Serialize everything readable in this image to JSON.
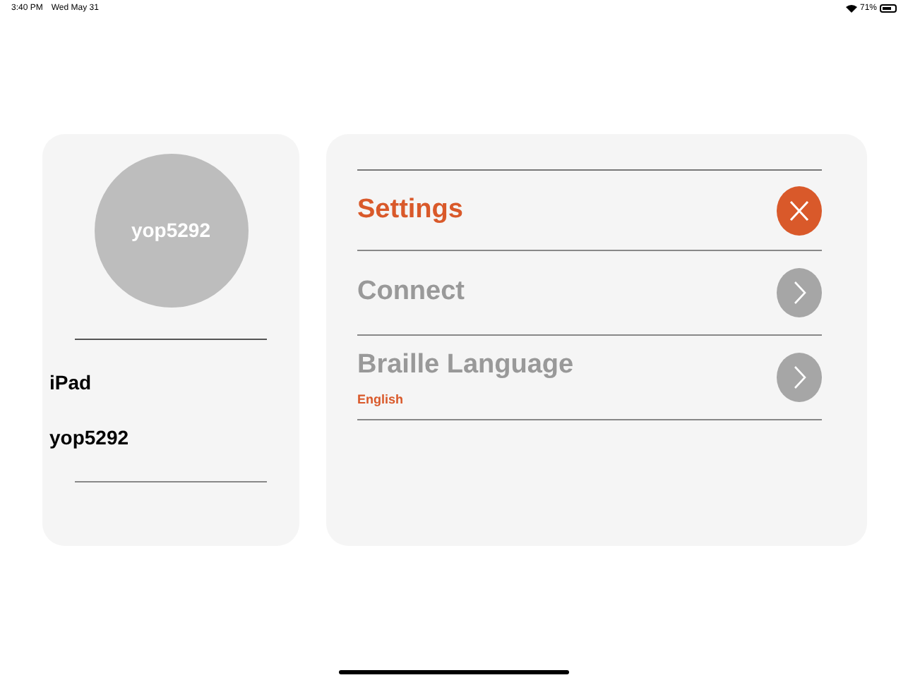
{
  "status_bar": {
    "time": "3:40 PM",
    "date": "Wed May 31",
    "battery": "71%"
  },
  "profile": {
    "avatar_text": "yop5292",
    "device": "iPad",
    "name": "yop5292"
  },
  "menu": [
    {
      "label": "Settings",
      "selected": true
    },
    {
      "label": "Connect",
      "selected": false
    },
    {
      "label": "Braille Language",
      "selected": false,
      "value": "English"
    }
  ]
}
